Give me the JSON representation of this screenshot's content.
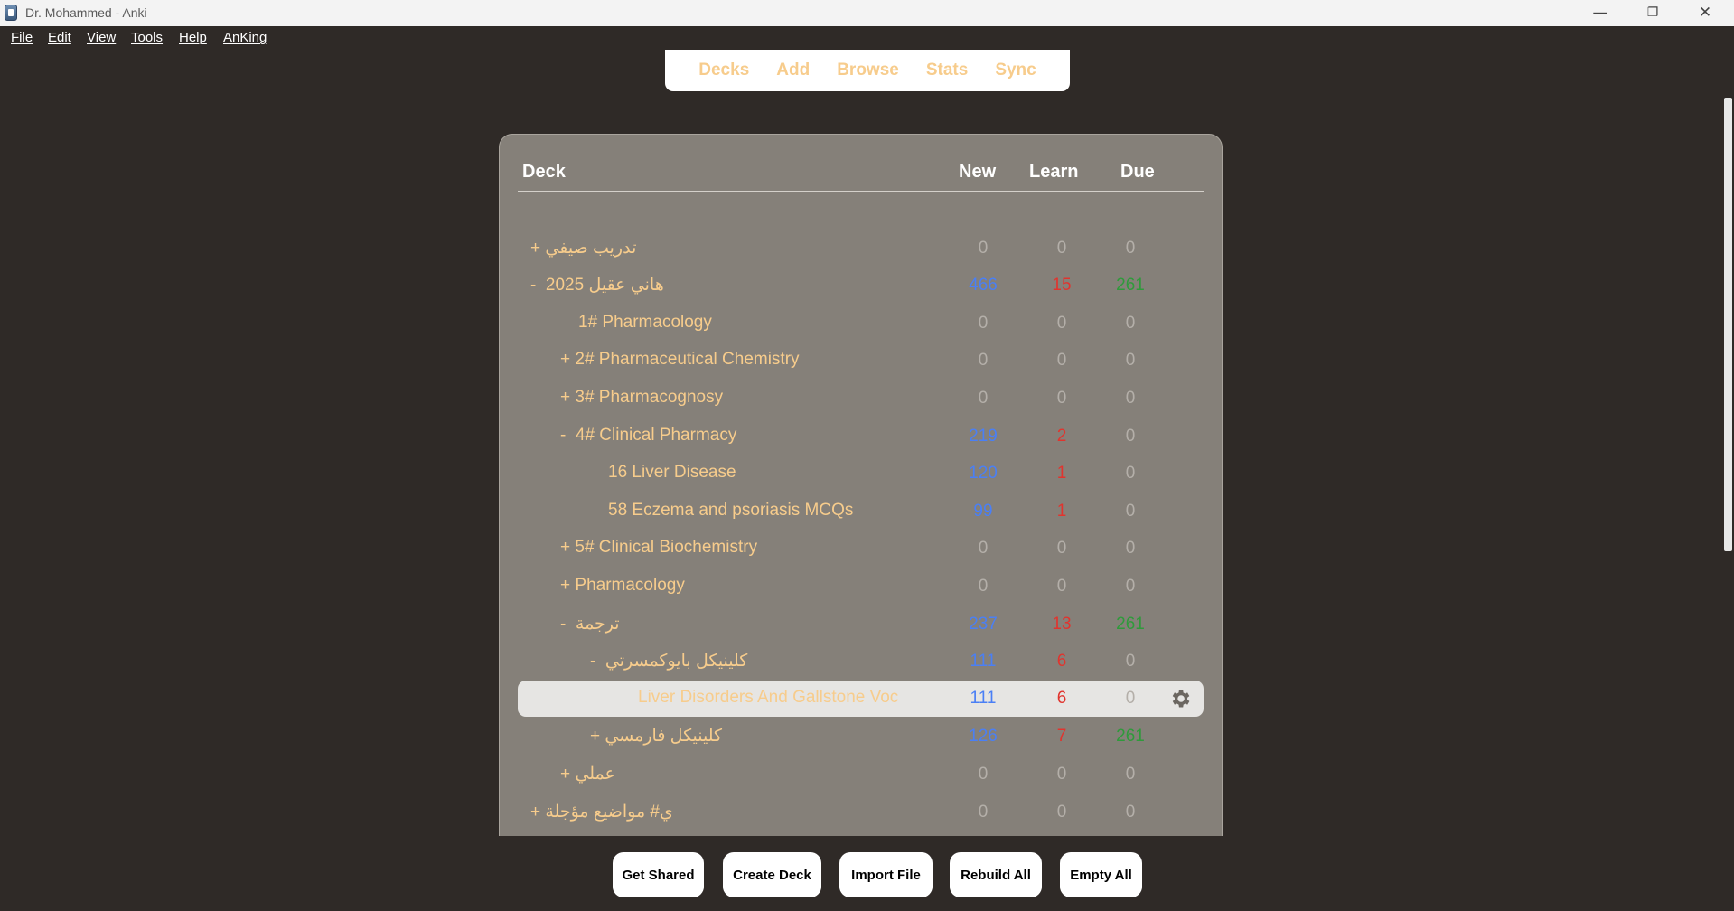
{
  "window": {
    "title": "Dr. Mohammed - Anki",
    "minimize": "—",
    "maximize": "❐",
    "close": "✕"
  },
  "menu": [
    "File",
    "Edit",
    "View",
    "Tools",
    "Help",
    "AnKing"
  ],
  "nav": [
    "Decks",
    "Add",
    "Browse",
    "Stats",
    "Sync"
  ],
  "headers": {
    "deck": "Deck",
    "new": "New",
    "learn": "Learn",
    "due": "Due"
  },
  "rows": [
    {
      "toggle": "+",
      "name": "تدريب صيفي",
      "new": "0",
      "learn": "0",
      "due": "0"
    },
    {
      "toggle": "-",
      "name": "هاني عقيل 2025",
      "new": "466",
      "learn": "15",
      "due": "261"
    },
    {
      "toggle": "",
      "name": "1# Pharmacology",
      "new": "0",
      "learn": "0",
      "due": "0"
    },
    {
      "toggle": "+",
      "name": "2# Pharmaceutical Chemistry",
      "new": "0",
      "learn": "0",
      "due": "0"
    },
    {
      "toggle": "+",
      "name": "3# Pharmacognosy",
      "new": "0",
      "learn": "0",
      "due": "0"
    },
    {
      "toggle": "-",
      "name": "4# Clinical Pharmacy",
      "new": "219",
      "learn": "2",
      "due": "0"
    },
    {
      "toggle": "",
      "name": "16 Liver Disease",
      "new": "120",
      "learn": "1",
      "due": "0"
    },
    {
      "toggle": "",
      "name": "58 Eczema and psoriasis MCQs",
      "new": "99",
      "learn": "1",
      "due": "0"
    },
    {
      "toggle": "+",
      "name": "5# Clinical Biochemistry",
      "new": "0",
      "learn": "0",
      "due": "0"
    },
    {
      "toggle": "+",
      "name": "Pharmacology",
      "new": "0",
      "learn": "0",
      "due": "0"
    },
    {
      "toggle": "-",
      "name": "ترجمة",
      "new": "237",
      "learn": "13",
      "due": "261"
    },
    {
      "toggle": "-",
      "name": "كلينيكل بايوكمسرتي",
      "new": "111",
      "learn": "6",
      "due": "0"
    },
    {
      "toggle": "",
      "name": "Liver Disorders And Gallstone Voc",
      "new": "111",
      "learn": "6",
      "due": "0"
    },
    {
      "toggle": "+",
      "name": "كلينيكل فارمسي",
      "new": "126",
      "learn": "7",
      "due": "261"
    },
    {
      "toggle": "+",
      "name": "عملي",
      "new": "0",
      "learn": "0",
      "due": "0"
    },
    {
      "toggle": "+",
      "name": "ي# مواضيع مؤجلة",
      "new": "0",
      "learn": "0",
      "due": "0"
    }
  ],
  "buttons": [
    "Get Shared",
    "Create Deck",
    "Import File",
    "Rebuild All",
    "Empty All"
  ],
  "colors": {
    "background": "#2f2a27",
    "panel": "#858079",
    "deck_text": "#f7cc8c",
    "new": "#4a7ff5",
    "learn": "#e1342e",
    "due": "#2f9a3b"
  },
  "icons": {
    "app": "anki-icon",
    "options": "gear-icon"
  }
}
